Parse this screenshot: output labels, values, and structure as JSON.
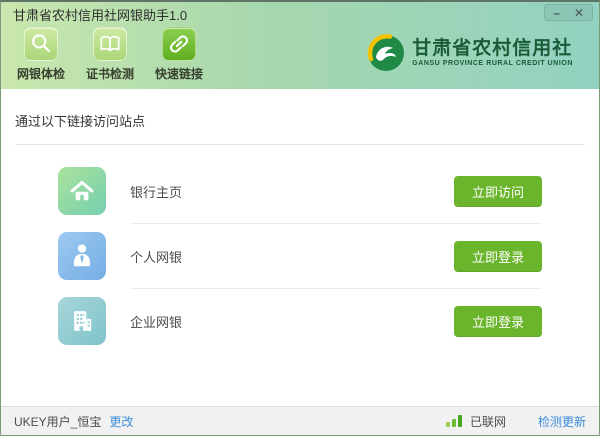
{
  "window": {
    "title": "甘肃省农村信用社网银助手1.0",
    "controls": {
      "minimize": "–",
      "close": "✕"
    }
  },
  "toolbar": {
    "items": [
      {
        "label": "网银体检",
        "icon": "magnifier-icon"
      },
      {
        "label": "证书检测",
        "icon": "book-icon"
      },
      {
        "label": "快速链接",
        "icon": "link-icon",
        "active": true
      }
    ]
  },
  "brand": {
    "name": "甘肃省农村信用社",
    "subtitle": "GANSU PROVINCE RURAL CREDIT UNION"
  },
  "main": {
    "section_title": "通过以下链接访问站点",
    "links": [
      {
        "label": "银行主页",
        "button": "立即访问",
        "icon": "home-icon"
      },
      {
        "label": "个人网银",
        "button": "立即登录",
        "icon": "person-icon"
      },
      {
        "label": "企业网银",
        "button": "立即登录",
        "icon": "building-icon"
      }
    ]
  },
  "statusbar": {
    "user": "UKEY用户_恒宝",
    "change_link": "更改",
    "network_status": "已联网",
    "update_link": "检测更新"
  },
  "colors": {
    "accent_green": "#6ab52c",
    "selected_tool_green": "#5fae1e",
    "link_blue": "#3e8ddb",
    "brand_green": "#1a5c38",
    "header_gradient_left": "#c9e7ae",
    "header_gradient_right": "#92d2c2"
  }
}
